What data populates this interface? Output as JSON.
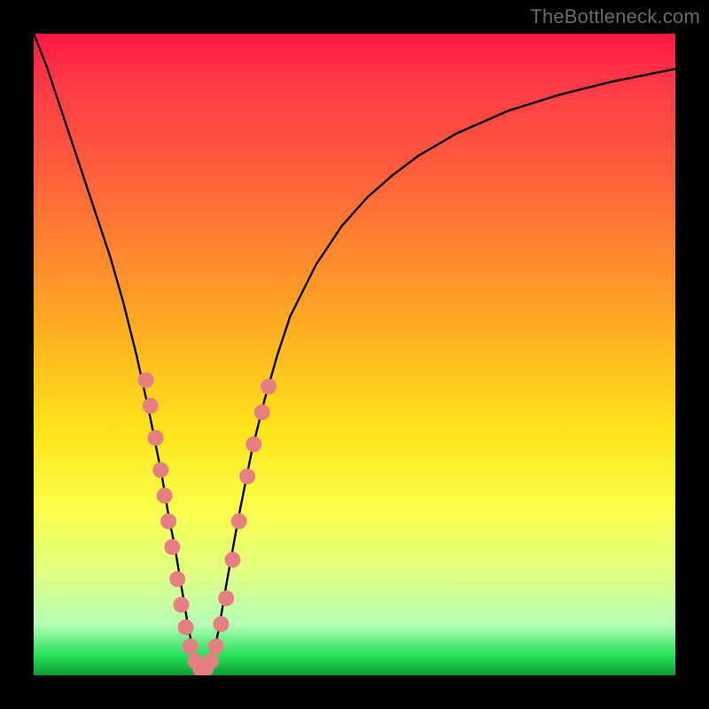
{
  "watermark": "TheBottleneck.com",
  "chart_data": {
    "type": "line",
    "title": "",
    "xlabel": "",
    "ylabel": "",
    "xlim": [
      0,
      100
    ],
    "ylim": [
      0,
      100
    ],
    "series": [
      {
        "name": "bottleneck-curve",
        "x": [
          0,
          2,
          4,
          6,
          8,
          10,
          12,
          14,
          16,
          18,
          19,
          20,
          21,
          22,
          23,
          24,
          25,
          26,
          27,
          28,
          29,
          30,
          32,
          34,
          36,
          38,
          40,
          44,
          48,
          52,
          56,
          60,
          66,
          74,
          82,
          90,
          100
        ],
        "y": [
          100,
          95,
          89,
          83,
          77,
          71,
          65,
          58,
          50,
          41,
          36,
          31,
          25,
          20,
          14,
          8,
          3,
          0.5,
          0.5,
          3,
          8,
          14,
          25,
          35,
          43,
          50,
          56,
          64,
          70,
          74.5,
          78,
          81,
          84.5,
          88,
          90.5,
          92.5,
          94.5
        ]
      }
    ],
    "markers": {
      "name": "match-points",
      "color": "#e77f82",
      "radius_px": 9,
      "points": [
        {
          "x": 17.5,
          "y": 46
        },
        {
          "x": 18.2,
          "y": 42
        },
        {
          "x": 19.0,
          "y": 37
        },
        {
          "x": 19.8,
          "y": 32
        },
        {
          "x": 20.4,
          "y": 28
        },
        {
          "x": 21.0,
          "y": 24
        },
        {
          "x": 21.6,
          "y": 20
        },
        {
          "x": 22.4,
          "y": 15
        },
        {
          "x": 23.0,
          "y": 11
        },
        {
          "x": 23.7,
          "y": 7.5
        },
        {
          "x": 24.4,
          "y": 4.5
        },
        {
          "x": 25.2,
          "y": 2.2
        },
        {
          "x": 26.0,
          "y": 1.0
        },
        {
          "x": 26.8,
          "y": 1.0
        },
        {
          "x": 27.6,
          "y": 2.2
        },
        {
          "x": 28.4,
          "y": 4.5
        },
        {
          "x": 29.2,
          "y": 8.0
        },
        {
          "x": 30.0,
          "y": 12
        },
        {
          "x": 31.0,
          "y": 18
        },
        {
          "x": 32.0,
          "y": 24
        },
        {
          "x": 33.3,
          "y": 31
        },
        {
          "x": 34.3,
          "y": 36
        },
        {
          "x": 35.6,
          "y": 41
        },
        {
          "x": 36.6,
          "y": 45
        }
      ]
    },
    "gradient_description": "vertical red-to-green representing bottleneck severity"
  }
}
